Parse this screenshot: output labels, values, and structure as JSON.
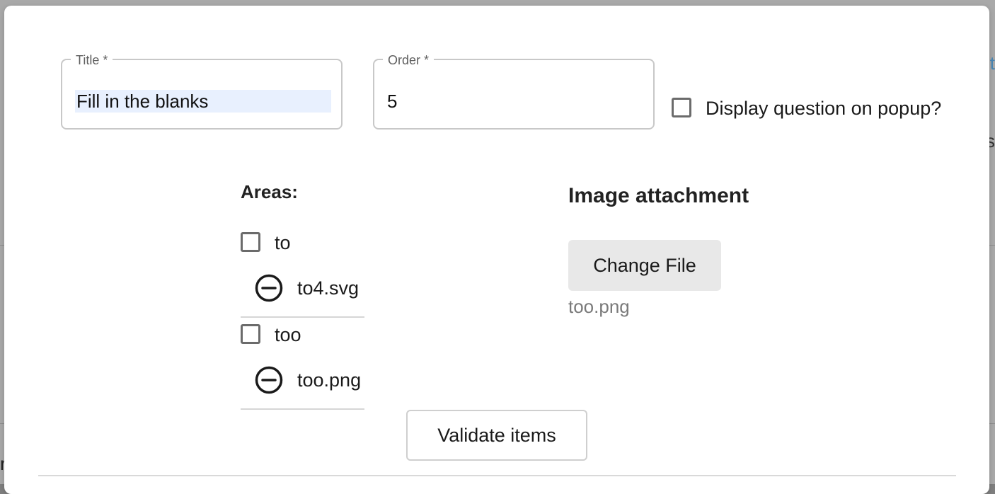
{
  "form": {
    "title_label": "Title *",
    "title_value": "Fill in the blanks",
    "order_label": "Order *",
    "order_value": "5",
    "popup_checkbox_label": "Display question on popup?"
  },
  "areas": {
    "heading": "Areas:",
    "items": [
      {
        "label": "to",
        "file": "to4.svg"
      },
      {
        "label": "too",
        "file": "too.png"
      }
    ]
  },
  "image_attachment": {
    "heading": "Image attachment",
    "change_file_label": "Change File",
    "file_name": "too.png"
  },
  "actions": {
    "validate_label": "Validate items"
  },
  "background": {
    "edge_text_1": "t",
    "edge_text_2": "s",
    "edge_text_3": "r"
  },
  "colors": {
    "selection_highlight": "#e8f0fe",
    "secondary_button_bg": "#e8e8e8",
    "link_color": "#4a87b5"
  }
}
